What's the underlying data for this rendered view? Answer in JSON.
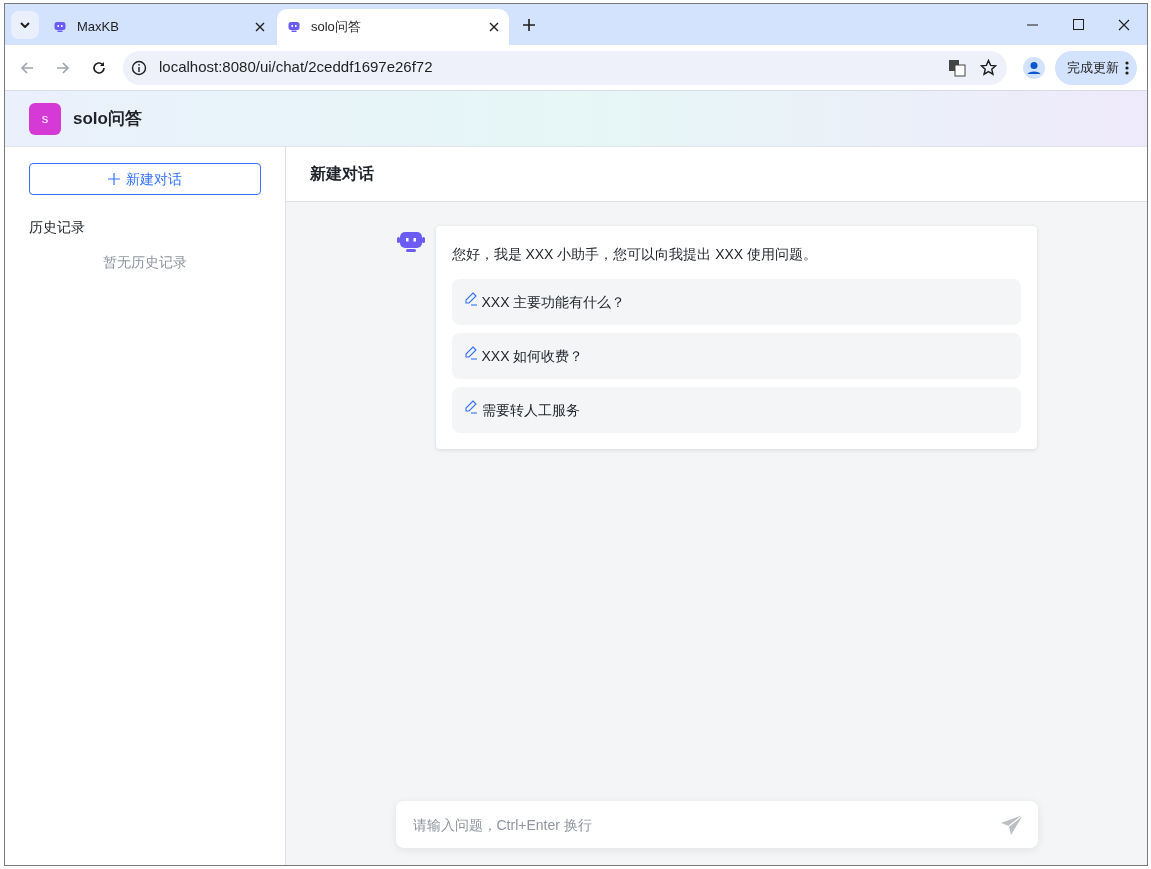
{
  "browser": {
    "tabs": [
      {
        "title": "MaxKB",
        "selected": false
      },
      {
        "title": "solo问答",
        "selected": true
      }
    ],
    "address": "localhost:8080/ui/chat/2ceddf1697e26f72",
    "update_button": "完成更新"
  },
  "app": {
    "logo_letter": "s",
    "title": "solo问答"
  },
  "sidebar": {
    "new_chat_button": "新建对话",
    "history_heading": "历史记录",
    "empty_text": "暂无历史记录"
  },
  "chat": {
    "title": "新建对话",
    "greeting": "您好，我是 XXX 小助手，您可以向我提出 XXX 使用问题。",
    "suggestions": [
      "XXX 主要功能有什么？",
      "XXX 如何收费？",
      "需要转人工服务"
    ],
    "input": {
      "placeholder": "请输入问题，Ctrl+Enter 换行"
    }
  }
}
